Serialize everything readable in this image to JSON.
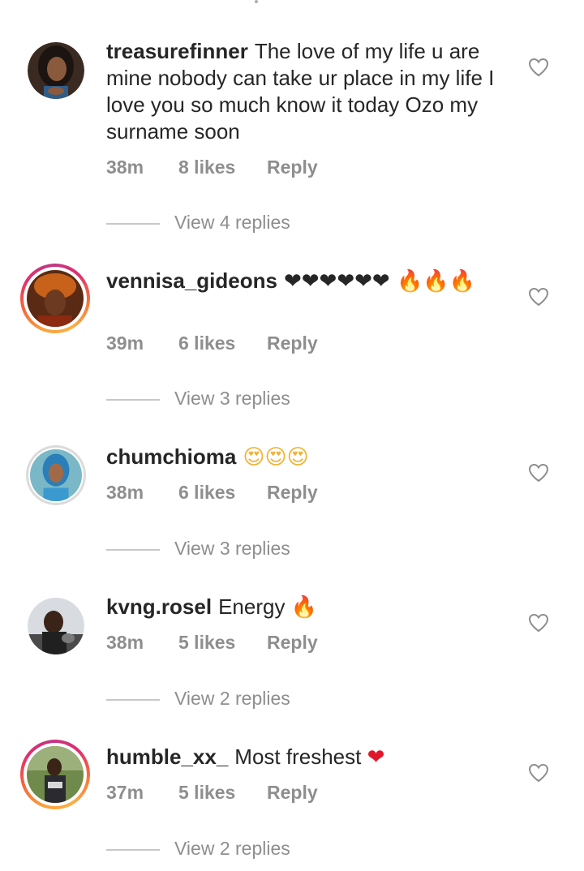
{
  "comments": [
    {
      "username": "treasurefinner",
      "text": "The love of my life u are mine nobody can take ur place in my life I love you so much know it today Ozo my surname soon",
      "emojis": "",
      "time": "38m",
      "likes": "8 likes",
      "reply": "Reply",
      "view_replies": "View 4 replies",
      "avatar_ring": "none"
    },
    {
      "username": "vennisa_gideons",
      "text": "",
      "emojis": "❤❤❤❤❤❤🔥🔥🔥",
      "time": "39m",
      "likes": "6 likes",
      "reply": "Reply",
      "view_replies": "View 3 replies",
      "avatar_ring": "story"
    },
    {
      "username": "chumchioma",
      "text": "",
      "emojis": "😍😍😍",
      "time": "38m",
      "likes": "6 likes",
      "reply": "Reply",
      "view_replies": "View 3 replies",
      "avatar_ring": "seen"
    },
    {
      "username": "kvng.rosel",
      "text": "Energy",
      "emojis": "🔥",
      "time": "38m",
      "likes": "5 likes",
      "reply": "Reply",
      "view_replies": "View 2 replies",
      "avatar_ring": "none"
    },
    {
      "username": "humble_xx_",
      "text": "Most freshest",
      "emojis": "❤",
      "time": "37m",
      "likes": "5 likes",
      "reply": "Reply",
      "view_replies": "View 2 replies",
      "avatar_ring": "story"
    }
  ],
  "icons": {
    "like": "heart-outline-icon"
  },
  "colors": {
    "text": "#262626",
    "muted": "#8e8e8e",
    "heart_emoji": "#e0162b",
    "fire_emoji": "#f68a1e",
    "story_ring": "#e1306c"
  }
}
